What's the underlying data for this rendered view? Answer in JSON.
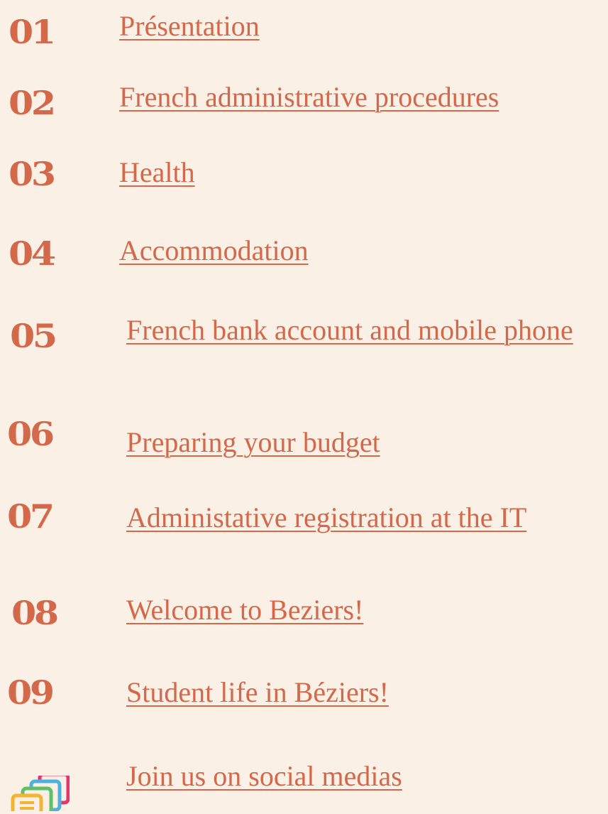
{
  "toc": {
    "items": [
      {
        "number": "01",
        "label": "Présentation"
      },
      {
        "number": "02",
        "label": "French administrative procedures"
      },
      {
        "number": "03",
        "label": "Health"
      },
      {
        "number": "04",
        "label": "Accommodation"
      },
      {
        "number": "05",
        "label": "French bank account and mobile phone"
      },
      {
        "number": "06",
        "label": "Preparing your budget"
      },
      {
        "number": "07",
        "label": "Administative registration at the IT"
      },
      {
        "number": "08",
        "label": "Welcome to Beziers!"
      },
      {
        "number": "09",
        "label": "Student life in Béziers!"
      }
    ],
    "social": {
      "icon": "stacked-documents-icon",
      "label": "Join us on social medias"
    }
  },
  "colors": {
    "background": "#fbf0e6",
    "accent": "#d3694a"
  }
}
